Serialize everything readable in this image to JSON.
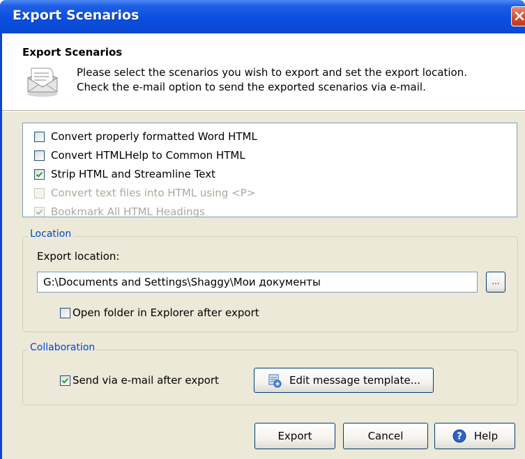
{
  "window": {
    "title": "Export Scenarios"
  },
  "header": {
    "title": "Export Scenarios",
    "desc_line1": "Please select the scenarios you wish to export and set the export location.",
    "desc_line2": "Check the e-mail option to send the exported scenarios via e-mail."
  },
  "scenarios": [
    {
      "label": "Convert properly formatted Word HTML",
      "checked": false,
      "enabled": true
    },
    {
      "label": "Convert HTMLHelp to Common HTML",
      "checked": false,
      "enabled": true
    },
    {
      "label": "Strip HTML and Streamline Text",
      "checked": true,
      "enabled": true
    },
    {
      "label": "Convert text files into HTML using <P>",
      "checked": false,
      "enabled": false
    },
    {
      "label": "Bookmark All HTML Headings",
      "checked": true,
      "enabled": false
    }
  ],
  "location": {
    "caption": "Location",
    "export_label": "Export location:",
    "path_value": "G:\\Documents and Settings\\Shaggy\\Мои документы",
    "browse_label": "...",
    "open_folder_label": "Open folder in Explorer after export",
    "open_folder_checked": false
  },
  "collaboration": {
    "caption": "Collaboration",
    "send_email_label": "Send via e-mail after export",
    "send_email_checked": true,
    "edit_template_label": "Edit message template..."
  },
  "buttons": {
    "export": "Export",
    "cancel": "Cancel",
    "help": "Help"
  },
  "colors": {
    "titlebar": "#0a48d2",
    "dialog_bg": "#ece9d8",
    "group_caption": "#0046d5",
    "checkmark": "#21a121",
    "close_button": "#d3492a"
  }
}
